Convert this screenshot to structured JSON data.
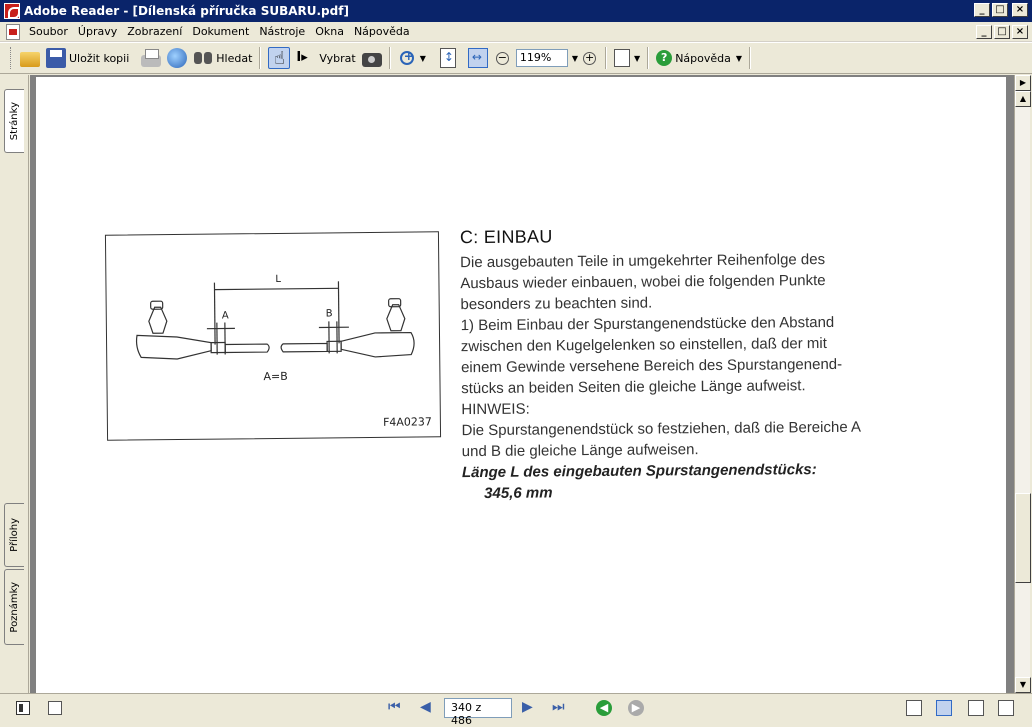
{
  "window": {
    "title": "Adobe Reader - [Dílenská příručka SUBARU.pdf]",
    "min": "_",
    "max": "□",
    "close": "×"
  },
  "menu": [
    "Soubor",
    "Úpravy",
    "Zobrazení",
    "Dokument",
    "Nástroje",
    "Okna",
    "Nápověda"
  ],
  "toolbar": {
    "save_copy": "Uložit kopii",
    "search": "Hledat",
    "select": "Vybrat",
    "zoom": "119%",
    "help": "Nápověda"
  },
  "side_tabs": {
    "pages": "Stránky",
    "attachments": "Přílohy",
    "comments": "Poznámky"
  },
  "figure": {
    "label_l": "L",
    "label_a": "A",
    "label_b": "B",
    "label_ab": "A=B",
    "code": "F4A0237"
  },
  "document": {
    "heading": "C: EINBAU",
    "lines": [
      "Die ausgebauten Teile in umgekehrter Reihenfolge des",
      "Ausbaus wieder einbauen, wobei die folgenden Punkte",
      "besonders zu beachten sind.",
      "1) Beim Einbau der Spurstangenendstücke den Abstand",
      "zwischen den Kugelgelenken so einstellen, daß der mit",
      "einem Gewinde versehene Bereich des Spurstangenend-",
      "stücks an beiden Seiten die gleiche Länge aufweist.",
      "HINWEIS:",
      "Die Spurstangenendstück so festziehen, daß die Bereiche A",
      "und B die gleiche Länge aufweisen."
    ],
    "spec_label": "Länge L des eingebauten Spurstangenendstücks:",
    "spec_value": "345,6 mm"
  },
  "status": {
    "page_indicator": "340 z 486"
  },
  "colors": {
    "titlebar": "#0a246a",
    "chrome": "#ece9d8",
    "doc_bg": "#808080"
  }
}
